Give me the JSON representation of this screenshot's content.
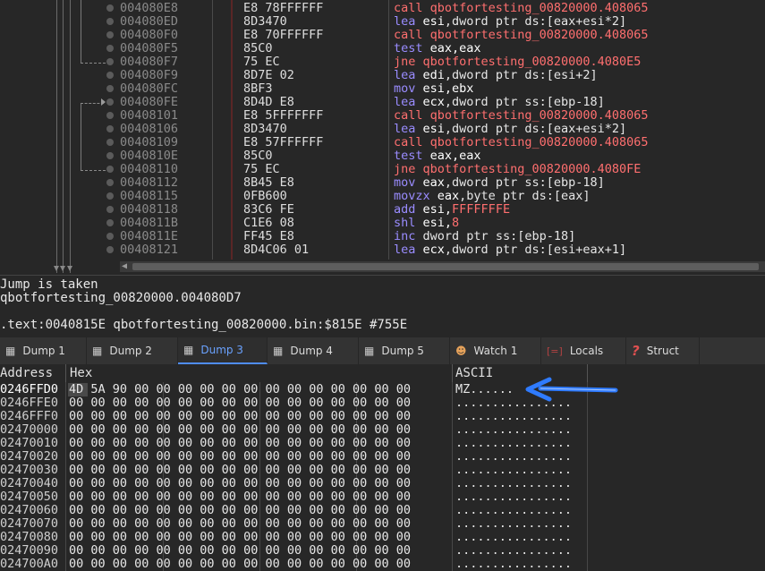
{
  "disasm": {
    "rows": [
      {
        "addr": "004080E8",
        "bytes": "E8 78FFFFFF",
        "mn": "call",
        "cls": "call",
        "ops": [
          {
            "t": "qbotfortesting_00820000.408065",
            "c": "red"
          }
        ]
      },
      {
        "addr": "004080ED",
        "bytes": "8D3470",
        "mn": "lea",
        "cls": "norm",
        "ops": [
          {
            "t": "esi",
            "c": "reg"
          },
          {
            "t": ",dword ptr ",
            "c": "pl"
          },
          {
            "t": "ds",
            "c": "pl"
          },
          {
            "t": ":[",
            "c": "pl"
          },
          {
            "t": "eax+esi*2",
            "c": "mem"
          },
          {
            "t": "]",
            "c": "pl"
          }
        ]
      },
      {
        "addr": "004080F0",
        "bytes": "E8 70FFFFFF",
        "mn": "call",
        "cls": "call",
        "ops": [
          {
            "t": "qbotfortesting_00820000.408065",
            "c": "red"
          }
        ]
      },
      {
        "addr": "004080F5",
        "bytes": "85C0",
        "mn": "test",
        "cls": "norm",
        "ops": [
          {
            "t": "eax,eax",
            "c": "reg"
          }
        ]
      },
      {
        "addr": "004080F7",
        "bytes": "75 EC",
        "mn": "jne",
        "cls": "jmp",
        "ops": [
          {
            "t": "qbotfortesting_00820000.4080E5",
            "c": "red"
          }
        ]
      },
      {
        "addr": "004080F9",
        "bytes": "8D7E 02",
        "mn": "lea",
        "cls": "norm",
        "ops": [
          {
            "t": "edi",
            "c": "reg"
          },
          {
            "t": ",dword ptr ",
            "c": "pl"
          },
          {
            "t": "ds",
            "c": "pl"
          },
          {
            "t": ":[",
            "c": "pl"
          },
          {
            "t": "esi+2",
            "c": "mem"
          },
          {
            "t": "]",
            "c": "pl"
          }
        ]
      },
      {
        "addr": "004080FC",
        "bytes": "8BF3",
        "mn": "mov",
        "cls": "norm",
        "ops": [
          {
            "t": "esi,ebx",
            "c": "reg"
          }
        ]
      },
      {
        "addr": "004080FE",
        "bytes": "8D4D E8",
        "mn": "lea",
        "cls": "norm",
        "ops": [
          {
            "t": "ecx",
            "c": "reg"
          },
          {
            "t": ",dword ptr ",
            "c": "pl"
          },
          {
            "t": "ss",
            "c": "pl"
          },
          {
            "t": ":[",
            "c": "pl"
          },
          {
            "t": "ebp-18",
            "c": "mem"
          },
          {
            "t": "]",
            "c": "pl"
          }
        ]
      },
      {
        "addr": "00408101",
        "bytes": "E8 5FFFFFFF",
        "mn": "call",
        "cls": "call",
        "ops": [
          {
            "t": "qbotfortesting_00820000.408065",
            "c": "red"
          }
        ]
      },
      {
        "addr": "00408106",
        "bytes": "8D3470",
        "mn": "lea",
        "cls": "norm",
        "ops": [
          {
            "t": "esi",
            "c": "reg"
          },
          {
            "t": ",dword ptr ",
            "c": "pl"
          },
          {
            "t": "ds",
            "c": "pl"
          },
          {
            "t": ":[",
            "c": "pl"
          },
          {
            "t": "eax+esi*2",
            "c": "mem"
          },
          {
            "t": "]",
            "c": "pl"
          }
        ]
      },
      {
        "addr": "00408109",
        "bytes": "E8 57FFFFFF",
        "mn": "call",
        "cls": "call",
        "ops": [
          {
            "t": "qbotfortesting_00820000.408065",
            "c": "red"
          }
        ]
      },
      {
        "addr": "0040810E",
        "bytes": "85C0",
        "mn": "test",
        "cls": "norm",
        "ops": [
          {
            "t": "eax,eax",
            "c": "reg"
          }
        ]
      },
      {
        "addr": "00408110",
        "bytes": "75 EC",
        "mn": "jne",
        "cls": "jmp",
        "ops": [
          {
            "t": "qbotfortesting_00820000.4080FE",
            "c": "red"
          }
        ]
      },
      {
        "addr": "00408112",
        "bytes": "8B45 E8",
        "mn": "mov",
        "cls": "norm",
        "ops": [
          {
            "t": "eax",
            "c": "reg"
          },
          {
            "t": ",dword ptr ",
            "c": "pl"
          },
          {
            "t": "ss",
            "c": "pl"
          },
          {
            "t": ":[",
            "c": "pl"
          },
          {
            "t": "ebp-18",
            "c": "mem"
          },
          {
            "t": "]",
            "c": "pl"
          }
        ]
      },
      {
        "addr": "00408115",
        "bytes": "0FB600",
        "mn": "movzx",
        "cls": "norm",
        "ops": [
          {
            "t": "eax",
            "c": "reg"
          },
          {
            "t": ",byte ptr ",
            "c": "pl"
          },
          {
            "t": "ds",
            "c": "pl"
          },
          {
            "t": ":[",
            "c": "pl"
          },
          {
            "t": "eax",
            "c": "mem"
          },
          {
            "t": "]",
            "c": "pl"
          }
        ]
      },
      {
        "addr": "00408118",
        "bytes": "83C6 FE",
        "mn": "add",
        "cls": "norm",
        "ops": [
          {
            "t": "esi,",
            "c": "reg"
          },
          {
            "t": "FFFFFFFE",
            "c": "red"
          }
        ]
      },
      {
        "addr": "0040811B",
        "bytes": "C1E6 08",
        "mn": "shl",
        "cls": "norm",
        "ops": [
          {
            "t": "esi,",
            "c": "reg"
          },
          {
            "t": "8",
            "c": "red"
          }
        ]
      },
      {
        "addr": "0040811E",
        "bytes": "FF45 E8",
        "mn": "inc",
        "cls": "norm",
        "ops": [
          {
            "t": "dword ptr ",
            "c": "pl"
          },
          {
            "t": "ss",
            "c": "pl"
          },
          {
            "t": ":[",
            "c": "pl"
          },
          {
            "t": "ebp-18",
            "c": "mem"
          },
          {
            "t": "]",
            "c": "pl"
          }
        ]
      },
      {
        "addr": "00408121",
        "bytes": "8D4C06 01",
        "mn": "lea",
        "cls": "norm",
        "ops": [
          {
            "t": "ecx",
            "c": "reg"
          },
          {
            "t": ",dword ptr ",
            "c": "pl"
          },
          {
            "t": "ds",
            "c": "pl"
          },
          {
            "t": ":[",
            "c": "pl"
          },
          {
            "t": "esi+eax+1",
            "c": "mem"
          },
          {
            "t": "]",
            "c": "pl"
          }
        ]
      }
    ]
  },
  "info": {
    "line1": "Jump is taken",
    "line2": "qbotfortesting_00820000.004080D7",
    "line3": ".text:0040815E qbotfortesting_00820000.bin:$815E #755E"
  },
  "tabs": [
    {
      "label": "Dump 1",
      "icon": "memory-icon"
    },
    {
      "label": "Dump 2",
      "icon": "memory-icon"
    },
    {
      "label": "Dump 3",
      "icon": "memory-icon",
      "active": true
    },
    {
      "label": "Dump 4",
      "icon": "memory-icon"
    },
    {
      "label": "Dump 5",
      "icon": "memory-icon"
    },
    {
      "label": "Watch 1",
      "icon": "watch-icon"
    },
    {
      "label": "Locals",
      "icon": "locals-icon"
    },
    {
      "label": "Struct",
      "icon": "struct-icon"
    }
  ],
  "dump": {
    "header": {
      "address": "Address",
      "hex": "Hex",
      "ascii": "ASCII"
    },
    "rows": [
      {
        "addr": "0246FFD0",
        "hex": "4D 5A 90 00 00 00 00 00 00 00 00 00 00 00 00 00",
        "ascii": "MZ......"
      },
      {
        "addr": "0246FFE0",
        "hex": "00 00 00 00 00 00 00 00 00 00 00 00 00 00 00 00",
        "ascii": "................"
      },
      {
        "addr": "0246FFF0",
        "hex": "00 00 00 00 00 00 00 00 00 00 00 00 00 00 00 00",
        "ascii": "................"
      },
      {
        "addr": "02470000",
        "hex": "00 00 00 00 00 00 00 00 00 00 00 00 00 00 00 00",
        "ascii": "................"
      },
      {
        "addr": "02470010",
        "hex": "00 00 00 00 00 00 00 00 00 00 00 00 00 00 00 00",
        "ascii": "................"
      },
      {
        "addr": "02470020",
        "hex": "00 00 00 00 00 00 00 00 00 00 00 00 00 00 00 00",
        "ascii": "................"
      },
      {
        "addr": "02470030",
        "hex": "00 00 00 00 00 00 00 00 00 00 00 00 00 00 00 00",
        "ascii": "................"
      },
      {
        "addr": "02470040",
        "hex": "00 00 00 00 00 00 00 00 00 00 00 00 00 00 00 00",
        "ascii": "................"
      },
      {
        "addr": "02470050",
        "hex": "00 00 00 00 00 00 00 00 00 00 00 00 00 00 00 00",
        "ascii": "................"
      },
      {
        "addr": "02470060",
        "hex": "00 00 00 00 00 00 00 00 00 00 00 00 00 00 00 00",
        "ascii": "................"
      },
      {
        "addr": "02470070",
        "hex": "00 00 00 00 00 00 00 00 00 00 00 00 00 00 00 00",
        "ascii": "................"
      },
      {
        "addr": "02470080",
        "hex": "00 00 00 00 00 00 00 00 00 00 00 00 00 00 00 00",
        "ascii": "................"
      },
      {
        "addr": "02470090",
        "hex": "00 00 00 00 00 00 00 00 00 00 00 00 00 00 00 00",
        "ascii": "................"
      },
      {
        "addr": "024700A0",
        "hex": "00 00 00 00 00 00 00 00 00 00 00 00 00 00 00 00",
        "ascii": "................"
      }
    ]
  },
  "colors": {
    "accent": "#4f8df5",
    "call": "#ff6f6f",
    "mnemonic": "#9a8cff",
    "arrow": "#2f7bff"
  }
}
